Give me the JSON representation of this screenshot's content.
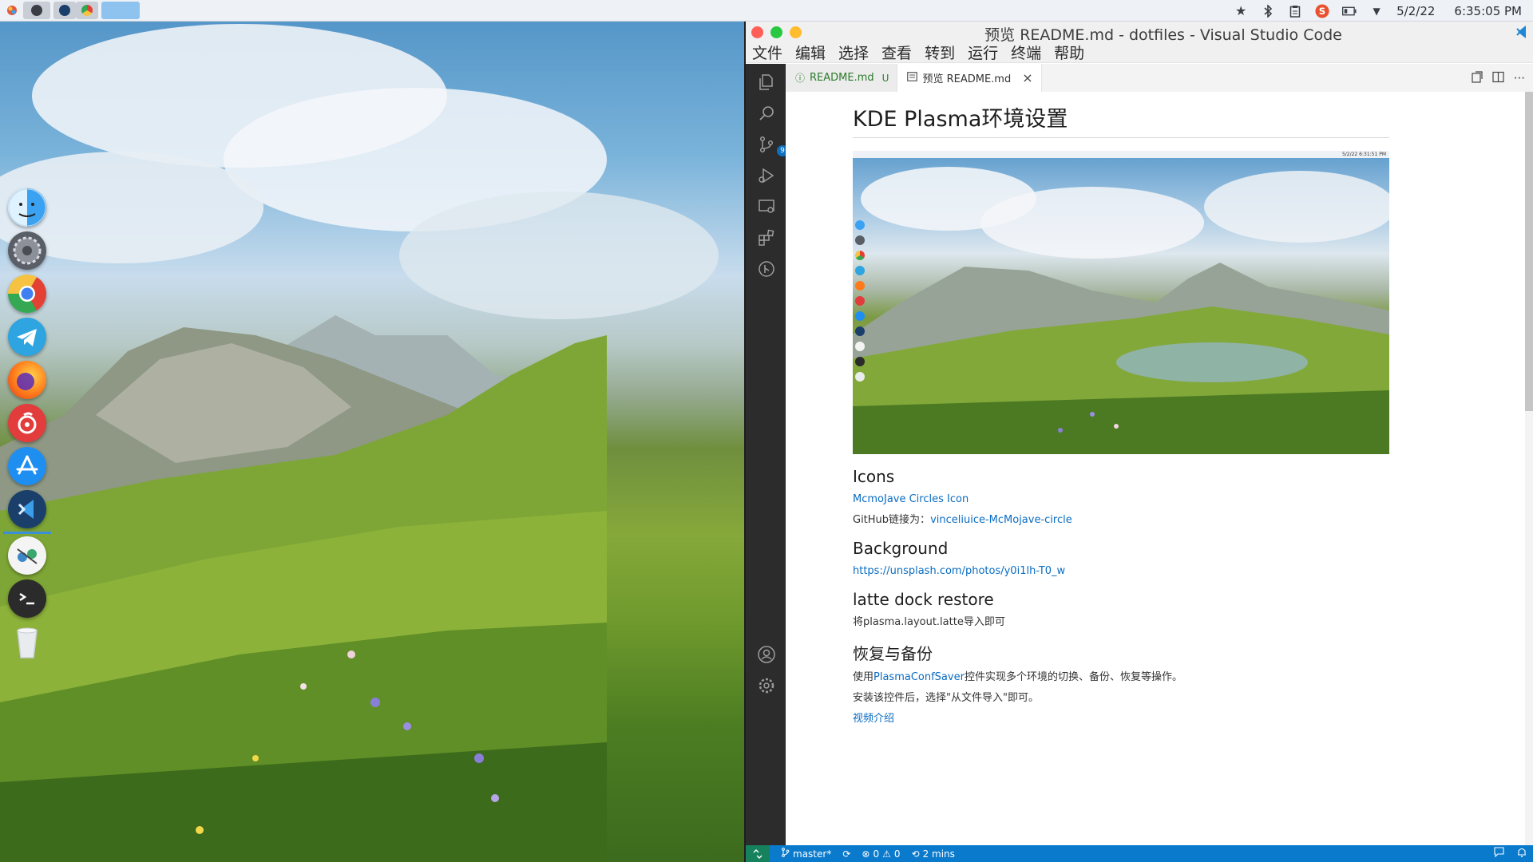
{
  "top_panel": {
    "tray": {
      "date": "5/2/22",
      "time": "6:35:05 PM",
      "icons": [
        "star-icon",
        "bluetooth-icon",
        "clipboard-icon",
        "sogou-input-icon",
        "battery-icon",
        "expand-tray-icon"
      ]
    },
    "tasks": [
      "obs-task",
      "vscode-task",
      "chrome-task",
      "empty-active-task"
    ]
  },
  "dock": {
    "items": [
      "finder-icon",
      "system-settings-icon",
      "chrome-icon",
      "telegram-icon",
      "firefox-icon",
      "netease-music-icon",
      "app-store-icon",
      "vscode-icon",
      "network-tool-icon",
      "terminal-icon",
      "trash-icon"
    ],
    "colors": {
      "finder": "#3aa2f0",
      "settings": "#5a5e66",
      "chrome": "#e8e8e8",
      "telegram": "#2ea4e0",
      "firefox": "#ff7a1a",
      "netease": "#e23c3c",
      "appstore": "#1f8ef1",
      "vscode": "#1b3f6b",
      "network": "#f4f4f4",
      "terminal": "#2b2b2b",
      "trash": "#e9ecef"
    }
  },
  "vscode": {
    "window_title": "预览 README.md - dotfiles - Visual Studio Code",
    "menu": [
      "文件",
      "编辑",
      "选择",
      "查看",
      "转到",
      "运行",
      "终端",
      "帮助"
    ],
    "activity_badge": "9",
    "tabs": [
      {
        "label": "README.md",
        "flag": "U"
      },
      {
        "label": "预览 README.md",
        "close": "×"
      }
    ],
    "tab_actions": [
      "open-source-icon",
      "split-editor-icon",
      "more-actions-icon"
    ],
    "markdown": {
      "h1": "KDE Plasma环境设置",
      "h2_icons": "Icons",
      "link_icons": "McmoJave Circles Icon",
      "github_prefix": "GitHub链接为：",
      "github_link": "vinceliuice-McMojave-circle",
      "h2_background": "Background",
      "bg_link": "https://unsplash.com/photos/y0i1lh-T0_w",
      "h2_latte": "latte dock restore",
      "latte_text": "将plasma.layout.latte导入即可",
      "h2_backup": "恢复与备份",
      "backup_prefix": "使用",
      "backup_link": "PlasmaConfSaver",
      "backup_suffix": "控件实现多个环境的切换、备份、恢复等操作。",
      "install_text": "安装该控件后，选择\"从文件导入\"即可。",
      "video_link": "视频介绍",
      "mini_clock": "5/2/22   6:31:51 PM"
    },
    "status": {
      "branch": "master*",
      "errors": "0",
      "warnings": "0",
      "time": "2 mins"
    },
    "colors": {
      "statusbar": "#0a7acc",
      "activitybar": "#2c2c2c",
      "link": "#0a6cc2"
    }
  }
}
